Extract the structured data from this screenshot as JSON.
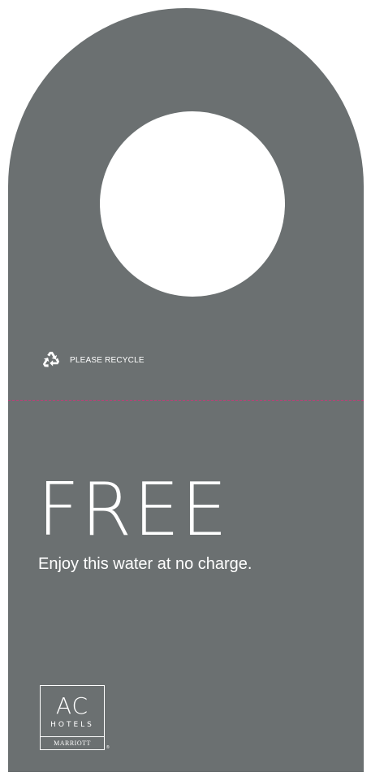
{
  "tag": {
    "recycle_notice": "PLEASE RECYCLE",
    "recycle_icon": "recycle-icon",
    "headline": "FREE",
    "tagline": "Enjoy this water at no charge."
  },
  "logo": {
    "line1": "AC",
    "line2": "HOTELS",
    "line3": "MARRIOTT",
    "registered_mark": "®"
  },
  "colors": {
    "tag_background": "#6b7071",
    "text": "#ffffff",
    "perforation_line": "#c43a78",
    "hole": "#ffffff"
  }
}
